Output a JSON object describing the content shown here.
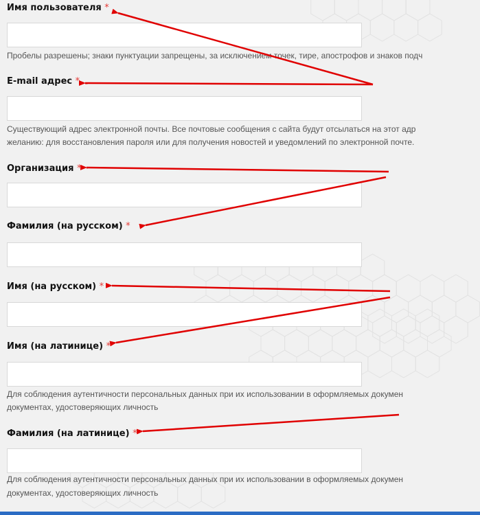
{
  "fields": [
    {
      "label": "Имя пользователя",
      "required": "*",
      "value": "",
      "hint": [
        "Пробелы разрешены; знаки пунктуации запрещены, за исключением точек, тире, апострофов и знаков подч"
      ]
    },
    {
      "label": "E-mail адрес",
      "required": "*",
      "value": "",
      "hint": [
        "Существующий адрес электронной почты. Все почтовые сообщения с сайта будут отсылаться на этот адр",
        "желанию: для восстановления пароля или для получения новостей и уведомлений по электронной почте."
      ]
    },
    {
      "label": "Организация",
      "required": "*",
      "value": "",
      "hint": []
    },
    {
      "label": "Фамилия (на русском)",
      "required": "*",
      "value": "",
      "hint": []
    },
    {
      "label": "Имя (на русском)",
      "required": "*",
      "value": "",
      "hint": []
    },
    {
      "label": "Имя (на латинице)",
      "required": "*",
      "value": "",
      "hint": [
        "Для соблюдения аутентичности персональных данных при их использовании в оформляемых докумен",
        "документах, удостоверяющих личность"
      ]
    },
    {
      "label": "Фамилия (на латинице)",
      "required": "*",
      "value": "",
      "hint": [
        "Для соблюдения аутентичности персональных данных при их использовании в оформляемых докумен",
        "документах, удостоверяющих личность"
      ]
    }
  ],
  "colors": {
    "arrow": "#e00000",
    "required": "#e53935",
    "bottom_bar": "#2b6cc4"
  }
}
